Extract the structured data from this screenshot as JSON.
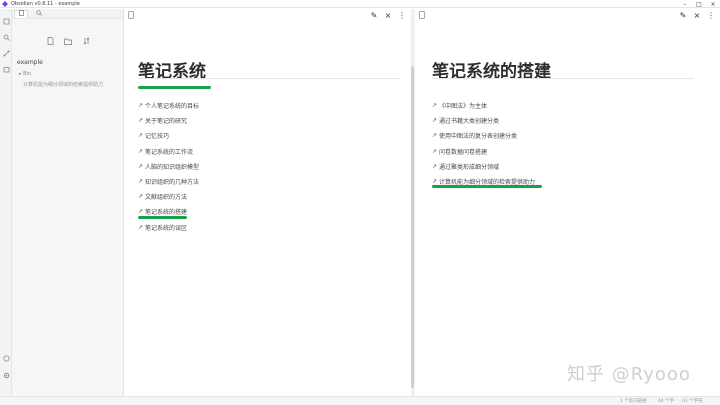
{
  "window": {
    "title": "Obsidian v0.8.11 - example",
    "controls": [
      "–",
      "□",
      "×"
    ]
  },
  "ribbon": {
    "icons": [
      "open-vault-icon",
      "search-icon",
      "graph-icon",
      "daily-note-icon",
      "help-icon",
      "settings-icon"
    ]
  },
  "explorer": {
    "tabs": [
      "file-icon",
      "search-icon"
    ],
    "actions": [
      "new-note-icon",
      "new-folder-icon",
      "sort-icon"
    ],
    "vault": "example",
    "folder": "▸ Bin",
    "file": "计算机能为细分领域的检索提供助力"
  },
  "pane_left": {
    "title": "笔记系统",
    "links": [
      "个人笔记系统的目标",
      "关于笔记的研究",
      "记忆技巧",
      "笔记系统的工作流",
      "人脑的知识组织模型",
      "知识组织的几种方法",
      "文献组织的方法",
      "笔记系统的搭建",
      "笔记系统的误区"
    ]
  },
  "pane_right": {
    "title": "笔记系统的搭建",
    "links": [
      "《中图法》为主体",
      "通过书籍大类创建分类",
      "使用中图法的复分表创建分类",
      "问卷数据问卷搭建",
      "通过聚类形成细分领域",
      "计算机能为细分领域的检索提供助力"
    ]
  },
  "pane_buttons": [
    "✎",
    "×",
    "⋮"
  ],
  "watermark": "知乎 @Ryooo",
  "status": {
    "backlinks": "1 个反向链接",
    "words": "44 个字",
    "chars": "61 个字符"
  },
  "colors": {
    "accent_underline": "#17a34a",
    "app_logo": "#7c3aed"
  }
}
